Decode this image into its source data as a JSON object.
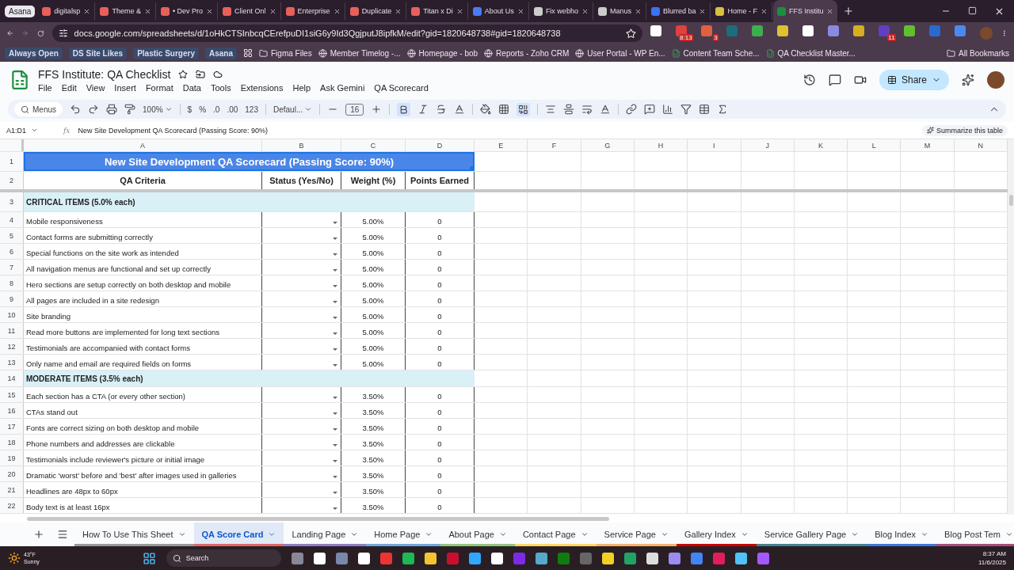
{
  "browser": {
    "tab_group": "Asana",
    "tabs": [
      {
        "label": "digitalsp",
        "selected": false
      },
      {
        "label": "Theme &",
        "selected": false
      },
      {
        "label": "• Dev Pro",
        "selected": false
      },
      {
        "label": "Client Onl",
        "selected": false
      },
      {
        "label": "Enterprise",
        "selected": false
      },
      {
        "label": "Duplicate",
        "selected": false
      },
      {
        "label": "Titan x Di",
        "selected": false
      },
      {
        "label": "About Us",
        "selected": false
      },
      {
        "label": "Fix webho",
        "selected": false
      },
      {
        "label": "Manus",
        "selected": false
      },
      {
        "label": "Blurred ba",
        "selected": false
      },
      {
        "label": "Home - F",
        "selected": false
      },
      {
        "label": "FFS Institu",
        "selected": true
      }
    ],
    "url": "docs.google.com/spreadsheets/d/1oHkCTSInbcqCErefpuDI1siG6y9Id3QgjputJ8ipfkM/edit?gid=1820648738#gid=1820648738",
    "extensions": [
      {
        "kind": "plain"
      },
      {
        "kind": "badged",
        "badge": "8:13"
      },
      {
        "kind": "badged",
        "badge": "3"
      },
      {
        "kind": "plain"
      },
      {
        "kind": "plain"
      },
      {
        "kind": "plain"
      },
      {
        "kind": "plain"
      },
      {
        "kind": "plain"
      },
      {
        "kind": "plain"
      },
      {
        "kind": "badged",
        "badge": "11"
      },
      {
        "kind": "plain"
      },
      {
        "kind": "plain"
      },
      {
        "kind": "plain"
      }
    ],
    "bookmark_chips": [
      "Always Open",
      "DS Site Likes",
      "Plastic Surgery",
      "Asana"
    ],
    "bookmarks": [
      {
        "label": "Figma Files",
        "kind": "folder"
      },
      {
        "label": "Member Timelog -...",
        "kind": "site"
      },
      {
        "label": "Homepage - bob",
        "kind": "site"
      },
      {
        "label": "Reports - Zoho CRM",
        "kind": "site"
      },
      {
        "label": "User Portal - WP En...",
        "kind": "site"
      },
      {
        "label": "Content Team Sche...",
        "kind": "sheet"
      },
      {
        "label": "QA Checklist Master...",
        "kind": "sheet"
      }
    ],
    "all_bookmarks": "All Bookmarks"
  },
  "doc": {
    "title": "FFS Institute: QA Checklist",
    "menu": [
      "File",
      "Edit",
      "View",
      "Insert",
      "Format",
      "Data",
      "Tools",
      "Extensions",
      "Help",
      "Ask Gemini",
      "QA Scorecard"
    ],
    "share": "Share"
  },
  "toolbar": {
    "search": "Menus",
    "zoom": "100%",
    "formats": [
      "$",
      "%",
      ".0",
      ".00",
      "123"
    ],
    "font": "Defaul...",
    "font_size": "16",
    "bold_on": true,
    "merge_on": true
  },
  "formula_bar": {
    "range": "A1:D1",
    "fx": "fx",
    "formula": "New Site Development QA Scorecard (Passing Score: 90%)",
    "summarize": "Summarize this table"
  },
  "grid": {
    "columns": [
      "A",
      "B",
      "C",
      "D",
      "E",
      "F",
      "G",
      "H",
      "I",
      "J",
      "K",
      "L",
      "M",
      "N"
    ],
    "rows": [
      {
        "number": "1",
        "kind": "title",
        "text": "New Site Development QA Scorecard (Passing Score: 90%)"
      },
      {
        "number": "2",
        "kind": "header",
        "cells": [
          "QA Criteria",
          "Status (Yes/No)",
          "Weight (%)",
          "Points Earned"
        ]
      },
      {
        "number": "3",
        "kind": "section",
        "text": "CRITICAL ITEMS (5.0% each)"
      },
      {
        "number": "4",
        "kind": "item",
        "criterion": "Mobile responsiveness",
        "weight": "5.00%",
        "points": "0"
      },
      {
        "number": "5",
        "kind": "item",
        "criterion": "Contact forms are submitting correctly",
        "weight": "5.00%",
        "points": "0"
      },
      {
        "number": "6",
        "kind": "item",
        "criterion": "Special functions on the site work as intended",
        "weight": "5.00%",
        "points": "0"
      },
      {
        "number": "7",
        "kind": "item",
        "criterion": "All navigation menus are functional and set up correctly",
        "weight": "5.00%",
        "points": "0"
      },
      {
        "number": "8",
        "kind": "item",
        "criterion": "Hero sections are setup correctly on both desktop and mobile",
        "weight": "5.00%",
        "points": "0"
      },
      {
        "number": "9",
        "kind": "item",
        "criterion": "All pages are included in a site redesign",
        "weight": "5.00%",
        "points": "0"
      },
      {
        "number": "10",
        "kind": "item",
        "criterion": "Site branding",
        "weight": "5.00%",
        "points": "0"
      },
      {
        "number": "11",
        "kind": "item",
        "criterion": "Read more buttons are implemented for long text sections",
        "weight": "5.00%",
        "points": "0"
      },
      {
        "number": "12",
        "kind": "item",
        "criterion": "Testimonials are accompanied with contact forms",
        "weight": "5.00%",
        "points": "0"
      },
      {
        "number": "13",
        "kind": "item",
        "criterion": "Only name and email are required fields on forms",
        "weight": "5.00%",
        "points": "0"
      },
      {
        "number": "14",
        "kind": "section",
        "text": "MODERATE ITEMS (3.5% each)"
      },
      {
        "number": "15",
        "kind": "item",
        "criterion": "Each section has a CTA (or every other section)",
        "weight": "3.50%",
        "points": "0"
      },
      {
        "number": "16",
        "kind": "item",
        "criterion": "CTAs stand out",
        "weight": "3.50%",
        "points": "0"
      },
      {
        "number": "17",
        "kind": "item",
        "criterion": "Fonts are correct sizing on both desktop and mobile",
        "weight": "3.50%",
        "points": "0"
      },
      {
        "number": "18",
        "kind": "item",
        "criterion": "Phone numbers and addresses are clickable",
        "weight": "3.50%",
        "points": "0"
      },
      {
        "number": "19",
        "kind": "item",
        "criterion": "Testimonials include reviewer's picture or initial image",
        "weight": "3.50%",
        "points": "0"
      },
      {
        "number": "20",
        "kind": "item",
        "criterion": "Dramatic 'worst' before and 'best' after images used in galleries",
        "weight": "3.50%",
        "points": "0"
      },
      {
        "number": "21",
        "kind": "item",
        "criterion": "Headlines are 48px to 60px",
        "weight": "3.50%",
        "points": "0"
      },
      {
        "number": "22",
        "kind": "item",
        "criterion": "Body text is at least 16px",
        "weight": "3.50%",
        "points": "0"
      }
    ]
  },
  "sheet_tabs": [
    {
      "label": "How To Use This Sheet",
      "selected": false,
      "color": "#999999"
    },
    {
      "label": "QA Score Card",
      "selected": true,
      "color": "#e06666"
    },
    {
      "label": "Landing Page",
      "selected": false,
      "color": "#8e7cc3"
    },
    {
      "label": "Home Page",
      "selected": false,
      "color": "#6fa8dc"
    },
    {
      "label": "About Page",
      "selected": false,
      "color": "#93c47d"
    },
    {
      "label": "Contact Page",
      "selected": false,
      "color": "#ffd966"
    },
    {
      "label": "Service Page",
      "selected": false,
      "color": "#f6b26b"
    },
    {
      "label": "Gallery Index",
      "selected": false,
      "color": "#cc0000"
    },
    {
      "label": "Service Gallery Page",
      "selected": false,
      "color": "#45818e"
    },
    {
      "label": "Blog Index",
      "selected": false,
      "color": "#3c78d8"
    },
    {
      "label": "Blog Post Tem",
      "selected": false,
      "color": "#a64d79"
    }
  ],
  "taskbar": {
    "temperature": "43°F",
    "weather": "Sunny",
    "search": "Search",
    "time": "8:37 AM",
    "date": "11/6/2025"
  }
}
